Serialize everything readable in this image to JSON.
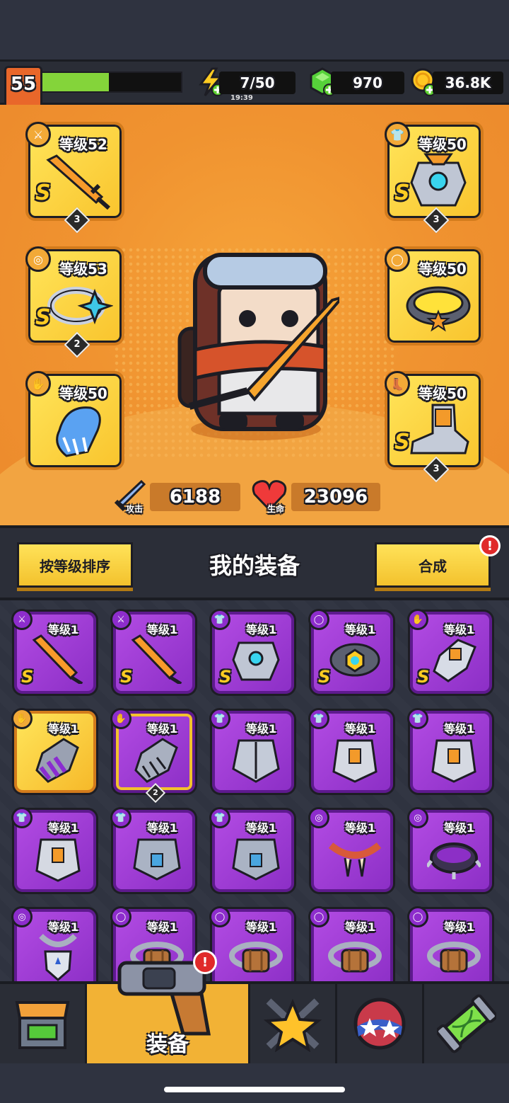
{
  "player": {
    "level": "55",
    "xp_progress": 0.48
  },
  "resources": {
    "energy": {
      "value": "7/50",
      "timer": "19:39",
      "icon": "lightning-plus-icon"
    },
    "gems": {
      "value": "970",
      "icon": "green-gem-plus-icon"
    },
    "gold": {
      "value": "36.8K",
      "icon": "gold-coin-plus-icon"
    }
  },
  "equipped": [
    {
      "slot": "weapon",
      "level": "等级52",
      "rank": "S",
      "stars": "3",
      "icon": "orange-sword-icon"
    },
    {
      "slot": "necklace",
      "level": "等级53",
      "rank": "S",
      "stars": "2",
      "icon": "star-ring-icon"
    },
    {
      "slot": "glove",
      "level": "等级50",
      "rank": "",
      "stars": "",
      "icon": "fur-glove-icon"
    },
    {
      "slot": "armor",
      "level": "等级50",
      "rank": "S",
      "stars": "3",
      "icon": "mech-armor-icon"
    },
    {
      "slot": "belt",
      "level": "等级50",
      "rank": "",
      "stars": "",
      "icon": "studded-belt-icon"
    },
    {
      "slot": "boots",
      "level": "等级50",
      "rank": "S",
      "stars": "3",
      "icon": "mech-boots-icon"
    }
  ],
  "stats": {
    "attack": {
      "label": "攻击",
      "value": "6188"
    },
    "health": {
      "label": "生命",
      "value": "23096"
    }
  },
  "section": {
    "sort_button": "按等级排序",
    "title": "我的装备",
    "merge_button": "合成",
    "alert": "!"
  },
  "inventory": [
    {
      "level": "等级1",
      "rank": "S",
      "gold": false,
      "stars": "",
      "icon": "orange-sword-icon",
      "type": "weapon"
    },
    {
      "level": "等级1",
      "rank": "S",
      "gold": false,
      "stars": "",
      "icon": "orange-sword-icon",
      "type": "weapon"
    },
    {
      "level": "等级1",
      "rank": "S",
      "gold": false,
      "stars": "",
      "icon": "mech-armor-icon",
      "type": "armor"
    },
    {
      "level": "等级1",
      "rank": "S",
      "gold": false,
      "stars": "",
      "icon": "gold-belt-icon",
      "type": "belt"
    },
    {
      "level": "等级1",
      "rank": "S",
      "gold": false,
      "stars": "",
      "icon": "mech-glove-icon",
      "type": "glove"
    },
    {
      "level": "等级1",
      "rank": "",
      "gold": true,
      "stars": "",
      "icon": "purple-claw-glove-icon",
      "type": "glove"
    },
    {
      "level": "等级1",
      "rank": "",
      "gold": false,
      "stars": "2",
      "icon": "steel-glove-icon",
      "type": "glove",
      "selected": true
    },
    {
      "level": "等级1",
      "rank": "",
      "gold": false,
      "stars": "",
      "icon": "steel-cuirass-icon",
      "type": "armor"
    },
    {
      "level": "等级1",
      "rank": "",
      "gold": false,
      "stars": "",
      "icon": "plate-armor-icon",
      "type": "armor"
    },
    {
      "level": "等级1",
      "rank": "",
      "gold": false,
      "stars": "",
      "icon": "plate-armor-icon",
      "type": "armor"
    },
    {
      "level": "等级1",
      "rank": "",
      "gold": false,
      "stars": "",
      "icon": "plate-armor-icon",
      "type": "armor"
    },
    {
      "level": "等级1",
      "rank": "",
      "gold": false,
      "stars": "",
      "icon": "chain-armor-icon",
      "type": "armor"
    },
    {
      "level": "等级1",
      "rank": "",
      "gold": false,
      "stars": "",
      "icon": "chain-armor-icon",
      "type": "armor"
    },
    {
      "level": "等级1",
      "rank": "",
      "gold": false,
      "stars": "",
      "icon": "fang-necklace-icon",
      "type": "necklace"
    },
    {
      "level": "等级1",
      "rank": "",
      "gold": false,
      "stars": "",
      "icon": "spiked-collar-icon",
      "type": "necklace"
    },
    {
      "level": "等级1",
      "rank": "",
      "gold": false,
      "stars": "",
      "icon": "shield-amulet-icon",
      "type": "necklace"
    },
    {
      "level": "等级1",
      "rank": "",
      "gold": false,
      "stars": "",
      "icon": "rope-belt-icon",
      "type": "belt"
    },
    {
      "level": "等级1",
      "rank": "",
      "gold": false,
      "stars": "",
      "icon": "rope-belt-icon",
      "type": "belt"
    },
    {
      "level": "等级1",
      "rank": "",
      "gold": false,
      "stars": "",
      "icon": "rope-belt-icon",
      "type": "belt"
    },
    {
      "level": "等级1",
      "rank": "",
      "gold": false,
      "stars": "",
      "icon": "rope-belt-icon",
      "type": "belt"
    }
  ],
  "nav": {
    "tabs": [
      {
        "id": "shop",
        "icon": "shop-stall-icon",
        "label": ""
      },
      {
        "id": "equipment",
        "icon": "revolver-icon",
        "label": "装备",
        "active": true,
        "alert": "!"
      },
      {
        "id": "talents",
        "icon": "star-swords-icon",
        "label": ""
      },
      {
        "id": "pets",
        "icon": "star-ball-icon",
        "label": ""
      },
      {
        "id": "evolve",
        "icon": "dna-capsule-icon",
        "label": ""
      }
    ]
  },
  "colors": {
    "hero_bg": "#f09330",
    "gold_card": "#f9c42d",
    "purple_card": "#9a3ad4",
    "accent_red": "#e02a2a"
  }
}
